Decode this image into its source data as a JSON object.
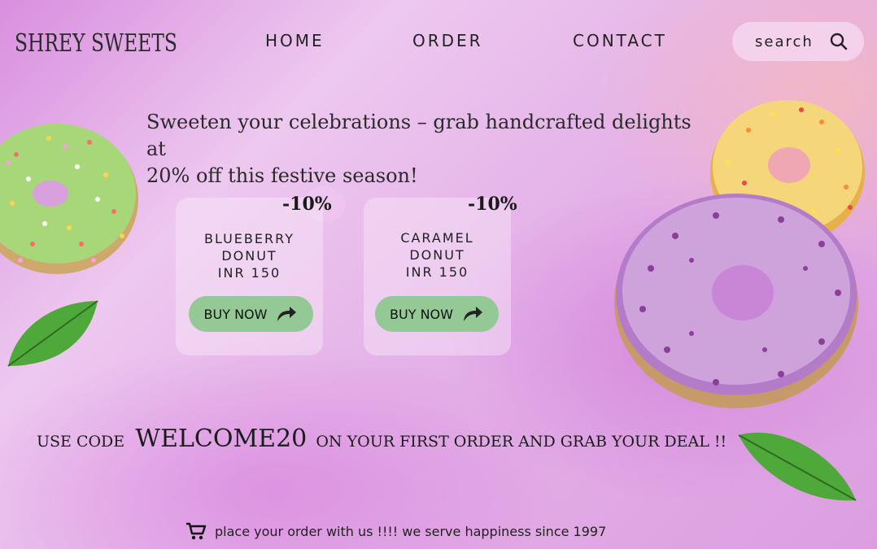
{
  "brand": {
    "name": "SHREY SWEETS"
  },
  "nav": {
    "items": [
      {
        "label": "HOME"
      },
      {
        "label": "ORDER"
      },
      {
        "label": "CONTACT"
      }
    ]
  },
  "search": {
    "label": "search",
    "icon": "search-icon"
  },
  "hero": {
    "line1": "Sweeten your celebrations – grab handcrafted delights at",
    "line2": "20% off this festive season!"
  },
  "products": [
    {
      "discount": "-10%",
      "title1": "BLUEBERRY",
      "title2": "DONUT",
      "price": "INR 150",
      "cta": "BUY NOW"
    },
    {
      "discount": "-10%",
      "title1": "CARAMEL",
      "title2": "DONUT",
      "price": "INR 150",
      "cta": "BUY NOW"
    }
  ],
  "promo": {
    "prefix": "USE CODE",
    "code": "WELCOME20",
    "suffix": "ON YOUR FIRST ORDER AND GRAB YOUR DEAL !!"
  },
  "footer": {
    "text": "place your order with us !!!! we serve happiness since 1997",
    "icon": "cart-icon"
  },
  "colors": {
    "button": "#94c996",
    "accent_pink": "#e4b2e8"
  }
}
